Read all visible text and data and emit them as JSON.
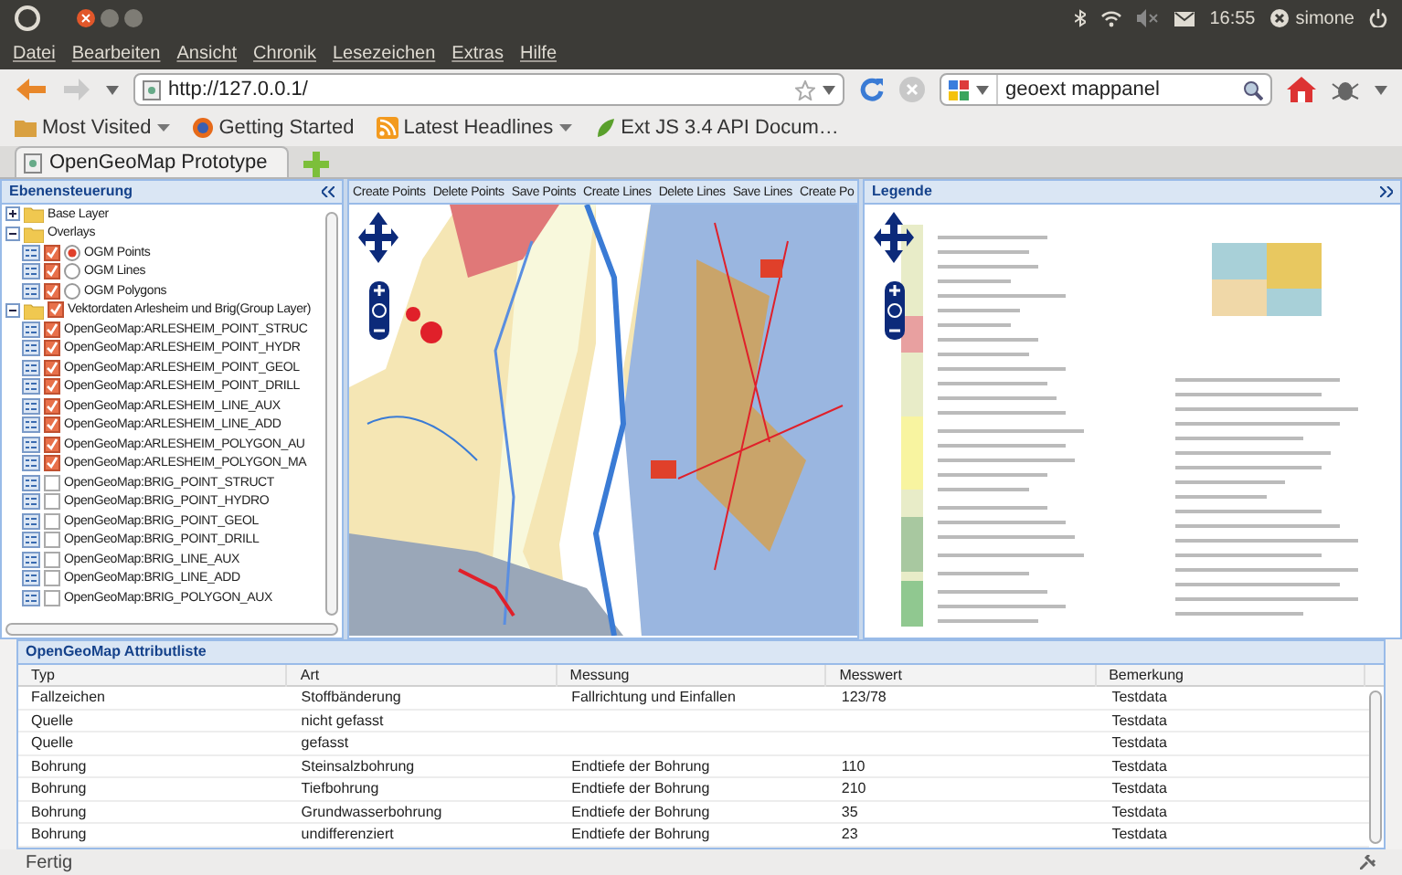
{
  "system_bar": {
    "clock": "16:55",
    "user": "simone"
  },
  "menu": [
    "Datei",
    "Bearbeiten",
    "Ansicht",
    "Chronik",
    "Lesezeichen",
    "Extras",
    "Hilfe"
  ],
  "nav": {
    "url": "http://127.0.0.1/",
    "search": "geoext mappanel"
  },
  "bookmarks": [
    {
      "label": "Most Visited",
      "kind": "folder",
      "dropdown": true
    },
    {
      "label": "Getting Started",
      "kind": "browser",
      "dropdown": false
    },
    {
      "label": "Latest Headlines",
      "kind": "feed",
      "dropdown": true
    },
    {
      "label": "Ext JS 3.4 API Docum…",
      "kind": "leaf",
      "dropdown": false
    }
  ],
  "tabs": [
    {
      "label": "OpenGeoMap Prototype",
      "selected": true
    }
  ],
  "layer_panel": {
    "title": "Ebenensteuerung",
    "tree": [
      {
        "kind": "folder",
        "label": "Base Layer",
        "expanded": false
      },
      {
        "kind": "folder",
        "label": "Overlays",
        "expanded": true,
        "children": [
          {
            "kind": "radio_layer",
            "label": "OGM Points",
            "checked": true,
            "selected": true
          },
          {
            "kind": "radio_layer",
            "label": "OGM Lines",
            "checked": true,
            "selected": false
          },
          {
            "kind": "radio_layer",
            "label": "OGM Polygons",
            "checked": true,
            "selected": false
          }
        ]
      },
      {
        "kind": "folder",
        "label": "Vektordaten Arlesheim und Brig(Group Layer)",
        "expanded": true,
        "checked": true,
        "children": [
          {
            "kind": "layer",
            "label": "OpenGeoMap:ARLESHEIM_POINT_STRUC",
            "checked": true
          },
          {
            "kind": "layer",
            "label": "OpenGeoMap:ARLESHEIM_POINT_HYDR",
            "checked": true
          },
          {
            "kind": "layer",
            "label": "OpenGeoMap:ARLESHEIM_POINT_GEOL",
            "checked": true
          },
          {
            "kind": "layer",
            "label": "OpenGeoMap:ARLESHEIM_POINT_DRILL",
            "checked": true
          },
          {
            "kind": "layer",
            "label": "OpenGeoMap:ARLESHEIM_LINE_AUX",
            "checked": true
          },
          {
            "kind": "layer",
            "label": "OpenGeoMap:ARLESHEIM_LINE_ADD",
            "checked": true
          },
          {
            "kind": "layer",
            "label": "OpenGeoMap:ARLESHEIM_POLYGON_AU",
            "checked": true
          },
          {
            "kind": "layer",
            "label": "OpenGeoMap:ARLESHEIM_POLYGON_MA",
            "checked": true
          },
          {
            "kind": "layer",
            "label": "OpenGeoMap:BRIG_POINT_STRUCT",
            "checked": false
          },
          {
            "kind": "layer",
            "label": "OpenGeoMap:BRIG_POINT_HYDRO",
            "checked": false
          },
          {
            "kind": "layer",
            "label": "OpenGeoMap:BRIG_POINT_GEOL",
            "checked": false
          },
          {
            "kind": "layer",
            "label": "OpenGeoMap:BRIG_POINT_DRILL",
            "checked": false
          },
          {
            "kind": "layer",
            "label": "OpenGeoMap:BRIG_LINE_AUX",
            "checked": false
          },
          {
            "kind": "layer",
            "label": "OpenGeoMap:BRIG_LINE_ADD",
            "checked": false
          },
          {
            "kind": "layer",
            "label": "OpenGeoMap:BRIG_POLYGON_AUX",
            "checked": false
          }
        ]
      }
    ]
  },
  "map_toolbar": [
    "Create Points",
    "Delete Points",
    "Save Points",
    "Create Lines",
    "Delete Lines",
    "Save Lines",
    "Create Po"
  ],
  "legend": {
    "title": "Legende"
  },
  "grid": {
    "title": "OpenGeoMap Attributliste",
    "columns": [
      "Typ",
      "Art",
      "Messung",
      "Messwert",
      "Bemerkung"
    ],
    "rows": [
      [
        "Fallzeichen",
        "Stoffbänderung",
        "Fallrichtung und Einfallen",
        "123/78",
        "Testdata"
      ],
      [
        "Quelle",
        "nicht gefasst",
        null,
        null,
        "Testdata"
      ],
      [
        "Quelle",
        "gefasst",
        null,
        null,
        "Testdata"
      ],
      [
        "Bohrung",
        "Steinsalzbohrung",
        "Endtiefe der Bohrung",
        "110",
        "Testdata"
      ],
      [
        "Bohrung",
        "Tiefbohrung",
        "Endtiefe der Bohrung",
        "210",
        "Testdata"
      ],
      [
        "Bohrung",
        "Grundwasserbohrung",
        "Endtiefe der Bohrung",
        "35",
        "Testdata"
      ],
      [
        "Bohrung",
        "undifferenziert",
        "Endtiefe der Bohrung",
        "23",
        "Testdata"
      ]
    ]
  },
  "status": "Fertig"
}
